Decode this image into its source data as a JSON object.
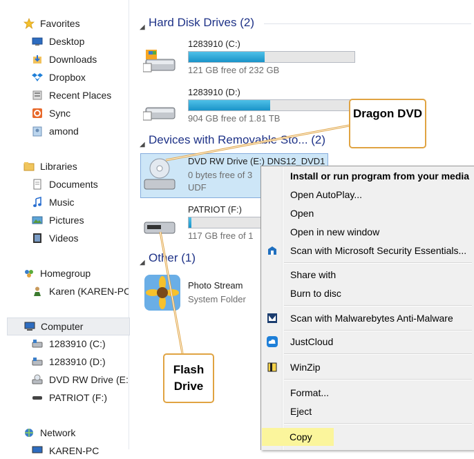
{
  "nav": {
    "favorites": {
      "label": "Favorites",
      "items": [
        {
          "label": "Desktop",
          "icon": "desktop-icon"
        },
        {
          "label": "Downloads",
          "icon": "downloads-icon"
        },
        {
          "label": "Dropbox",
          "icon": "dropbox-icon"
        },
        {
          "label": "Recent Places",
          "icon": "recent-places-icon"
        },
        {
          "label": "Sync",
          "icon": "sync-icon"
        },
        {
          "label": "amond",
          "icon": "user-folder-icon"
        }
      ]
    },
    "libraries": {
      "label": "Libraries",
      "items": [
        {
          "label": "Documents",
          "icon": "documents-icon"
        },
        {
          "label": "Music",
          "icon": "music-icon"
        },
        {
          "label": "Pictures",
          "icon": "pictures-icon"
        },
        {
          "label": "Videos",
          "icon": "videos-icon"
        }
      ]
    },
    "homegroup": {
      "label": "Homegroup",
      "items": [
        {
          "label": "Karen (KAREN-PC",
          "icon": "user-icon"
        }
      ]
    },
    "computer": {
      "label": "Computer",
      "items": [
        {
          "label": "1283910 (C:)",
          "icon": "hard-drive-icon"
        },
        {
          "label": "1283910 (D:)",
          "icon": "hard-drive-icon"
        },
        {
          "label": "DVD RW Drive (E:",
          "icon": "dvd-drive-icon"
        },
        {
          "label": "PATRIOT (F:)",
          "icon": "usb-drive-icon"
        }
      ]
    },
    "network": {
      "label": "Network",
      "items": [
        {
          "label": "KAREN-PC",
          "icon": "pc-icon"
        }
      ]
    }
  },
  "content": {
    "groups": {
      "hdd": "Hard Disk Drives (2)",
      "removable": "Devices with Removable Sto... (2)",
      "other": "Other (1)"
    },
    "drives": [
      {
        "name": "1283910 (C:)",
        "free": "121 GB free of 232 GB",
        "used_fraction": 0.48
      },
      {
        "name": "1283910 (D:)",
        "free": "904 GB free of 1.81 TB",
        "used_fraction": 0.5
      },
      {
        "name": "DVD RW Drive (E:) DNS12_DVD1",
        "free": "0 bytes free of 3",
        "fs": "UDF"
      },
      {
        "name": "PATRIOT (F:)",
        "free": "117 GB free of 1",
        "used_fraction": 0.04
      }
    ],
    "other_item": {
      "name": "Photo Stream",
      "sub": "System Folder"
    }
  },
  "context_menu": {
    "items": [
      "Install or run program from your media",
      "Open AutoPlay...",
      "Open",
      "Open in new window",
      "Scan with Microsoft Security Essentials...",
      "Share with",
      "Burn to disc",
      "Scan with Malwarebytes Anti-Malware",
      "JustCloud",
      "WinZip",
      "Format...",
      "Eject",
      "Copy"
    ]
  },
  "callouts": {
    "dragon": "Dragon DVD",
    "flash": "Flash Drive"
  },
  "colors": {
    "accent_header": "#1e3287",
    "selection_bg": "#cde6f7",
    "highlight": "#fbf59c",
    "callout_border": "#e0a341",
    "bar_fill": "#26a0da"
  }
}
